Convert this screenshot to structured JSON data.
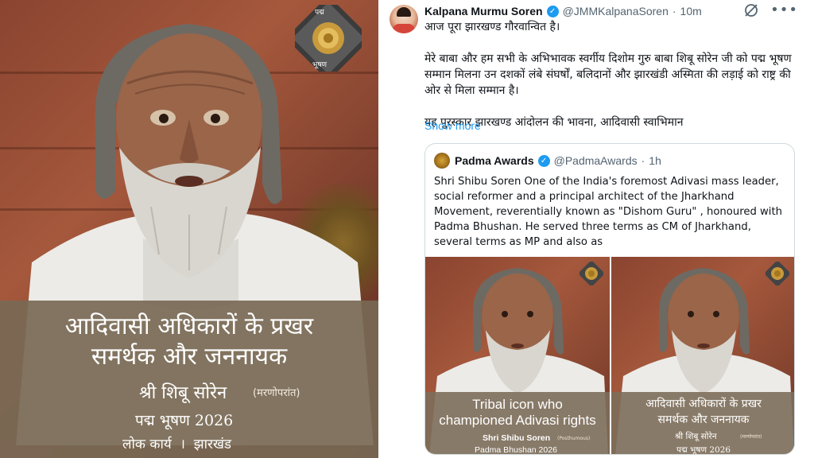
{
  "poster": {
    "medal_text": "पद्म भूषण",
    "title_line1": "आदिवासी अधिकारों के प्रखर",
    "title_line2": "समर्थक और जननायक",
    "name": "श्री शिबू सोरेन",
    "name_note": "(मरणोपरांत)",
    "award": "पद्म भूषण 2026",
    "field": "लोक कार्य  ।  झारखंड"
  },
  "tweet": {
    "author_name": "Kalpana Murmu Soren",
    "handle": "@JMMKalpanaSoren",
    "separator": "·",
    "time": "10m",
    "paragraphs": [
      "आज पूरा झारखण्ड गौरवान्वित है।",
      "मेरे बाबा और हम सभी के अभिभावक स्वर्गीय दिशोम गुरु बाबा शिबू सोरेन जी को पद्म भूषण सम्मान मिलना उन दशकों लंबे संघर्षों, बलिदानों और झारखंडी अस्मिता की लड़ाई को राष्ट्र की ओर से मिला सम्मान है।",
      "यह पुरस्कार झारखण्ड आंदोलन की भावना, आदिवासी स्वाभिमान"
    ],
    "show_more": "Show more",
    "icons": {
      "grok": "grok-icon",
      "more": "more-icon",
      "verified": "verified-badge-icon"
    },
    "colors": {
      "link": "#1d9bf0",
      "muted": "#536471",
      "text": "#0f1419"
    }
  },
  "quote": {
    "author_name": "Padma Awards",
    "handle": "@PadmaAwards",
    "separator": "·",
    "time": "1h",
    "text": "Shri Shibu Soren One of the India's foremost Adivasi mass leader, social reformer and a principal architect of the Jharkhand Movement, reverentially known as \"Dishom Guru\" , honoured with Padma Bhushan. He served three terms as CM of Jharkhand, several terms as MP and also as",
    "image_left": {
      "line1": "Tribal icon who",
      "line2": "championed Adivasi rights",
      "name": "Shri Shibu Soren",
      "name_note": "(Posthumous)",
      "award": "Padma Bhushan 2026"
    },
    "image_right": {
      "line1": "आदिवासी अधिकारों के प्रखर",
      "line2": "समर्थक और जननायक",
      "name": "श्री शिबू सोरेन",
      "name_note": "(मरणोपरांत)",
      "award": "पद्म भूषण 2026"
    }
  }
}
